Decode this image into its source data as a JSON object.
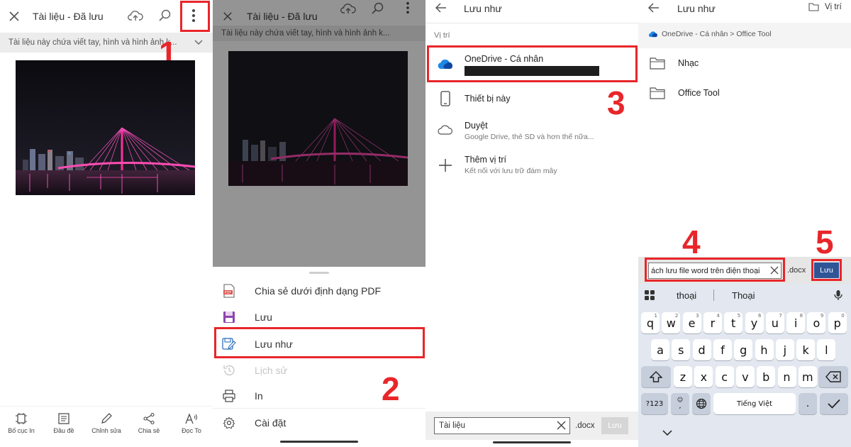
{
  "panel1": {
    "title": "Tài liệu - Đã lưu",
    "notice": "Tài liệu này chứa viết tay, hình và hình ảnh k...",
    "step": "1",
    "tools": [
      {
        "label": "Bố cục In",
        "icon": "layout-icon"
      },
      {
        "label": "Đầu đề",
        "icon": "heading-icon"
      },
      {
        "label": "Chỉnh sửa",
        "icon": "pencil-icon"
      },
      {
        "label": "Chia sẻ",
        "icon": "share-icon"
      },
      {
        "label": "Đọc To",
        "icon": "read-aloud-icon"
      }
    ]
  },
  "panel2": {
    "title": "Tài liệu - Đã lưu",
    "notice": "Tài liệu này chứa viết tay, hình và hình ảnh k...",
    "step": "2",
    "menu": [
      {
        "label": "Chia sẻ dưới định dạng PDF",
        "icon": "pdf-icon"
      },
      {
        "label": "Lưu",
        "icon": "save-icon"
      },
      {
        "label": "Lưu như",
        "icon": "save-as-icon"
      },
      {
        "label": "Lịch sử",
        "icon": "history-icon"
      },
      {
        "label": "In",
        "icon": "print-icon"
      },
      {
        "label": "Cài đặt",
        "icon": "settings-gear-icon"
      }
    ]
  },
  "panel3": {
    "title": "Lưu như",
    "section": "Vị trí",
    "step": "3",
    "locations": [
      {
        "label": "OneDrive - Cá nhân",
        "sub": "",
        "icon": "onedrive-cloud-icon"
      },
      {
        "label": "Thiết bị này",
        "sub": "",
        "icon": "phone-icon"
      },
      {
        "label": "Duyệt",
        "sub": "Google Drive, thẻ SD và hơn thế nữa...",
        "icon": "cloud-outline-icon"
      },
      {
        "label": "Thêm vị trí",
        "sub": "Kết nối với lưu trữ đám mây",
        "icon": "plus-icon"
      }
    ],
    "filename": "Tài liệu",
    "ext": ".docx",
    "save": "Lưu"
  },
  "panel4": {
    "title": "Lưu như",
    "location_button": "Vị trí",
    "breadcrumb": "OneDrive - Cá nhân > Office Tool",
    "folders": [
      "Nhạc",
      "Office Tool"
    ],
    "filename": "ách lưu file word trên điện thoại",
    "ext": ".docx",
    "save": "Lưu",
    "step4": "4",
    "step5": "5",
    "suggestions": [
      "thoại",
      "Thoại"
    ],
    "keyboard": {
      "row1": [
        "q",
        "w",
        "e",
        "r",
        "t",
        "y",
        "u",
        "i",
        "o",
        "p"
      ],
      "row1_nums": [
        "1",
        "2",
        "3",
        "4",
        "5",
        "6",
        "7",
        "8",
        "9",
        "0"
      ],
      "row2": [
        "a",
        "s",
        "d",
        "f",
        "g",
        "h",
        "j",
        "k",
        "l"
      ],
      "row3": [
        "z",
        "x",
        "c",
        "v",
        "b",
        "n",
        "m"
      ],
      "sym": "?123",
      "emoji_comma": ",",
      "space": "Tiếng Việt",
      "period": "."
    }
  }
}
